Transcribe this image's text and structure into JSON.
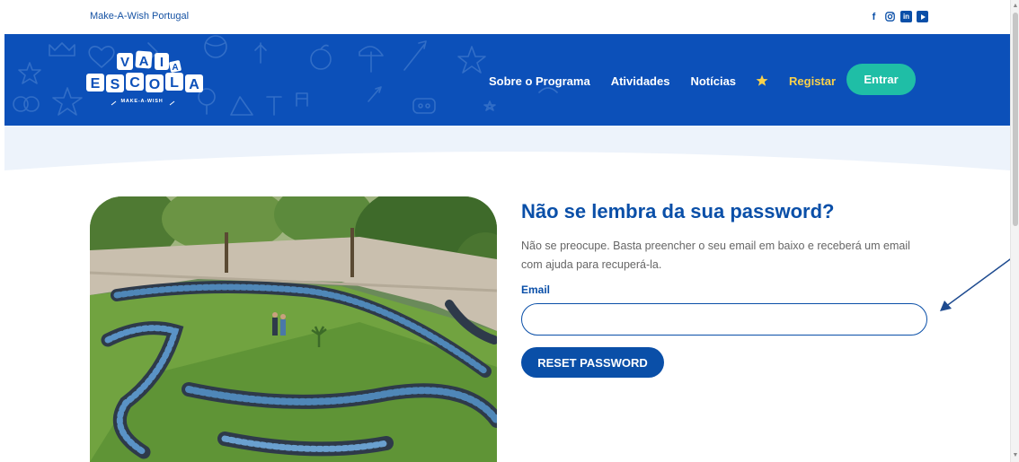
{
  "topbar": {
    "brand_link": "Make-A-Wish Portugal",
    "social_icons": [
      "facebook-icon",
      "instagram-icon",
      "linkedin-icon",
      "youtube-icon"
    ]
  },
  "header": {
    "logo": {
      "word1": [
        "V",
        "A",
        "I"
      ],
      "word1_small": "A",
      "word2": [
        "E",
        "S",
        "C",
        "O",
        "L",
        "A"
      ],
      "tagline": "MAKE-A-WISH"
    },
    "nav": {
      "sobre": "Sobre o Programa",
      "atividades": "Atividades",
      "noticias": "Notícias",
      "star_icon": "star-icon",
      "registar": "Registar"
    },
    "login_button": "Entrar"
  },
  "colors": {
    "header_blue": "#0c50b9",
    "brand_blue": "#0a4fa8",
    "teal": "#1fbea6",
    "yellow": "#f9d14b"
  },
  "form": {
    "title": "Não se lembra da sua password?",
    "description": "Não se preocupe. Basta preencher o seu email em baixo e receberá um email com ajuda para recuperá-la.",
    "email_label": "Email",
    "email_value": "",
    "submit_label": "RESET PASSWORD"
  }
}
